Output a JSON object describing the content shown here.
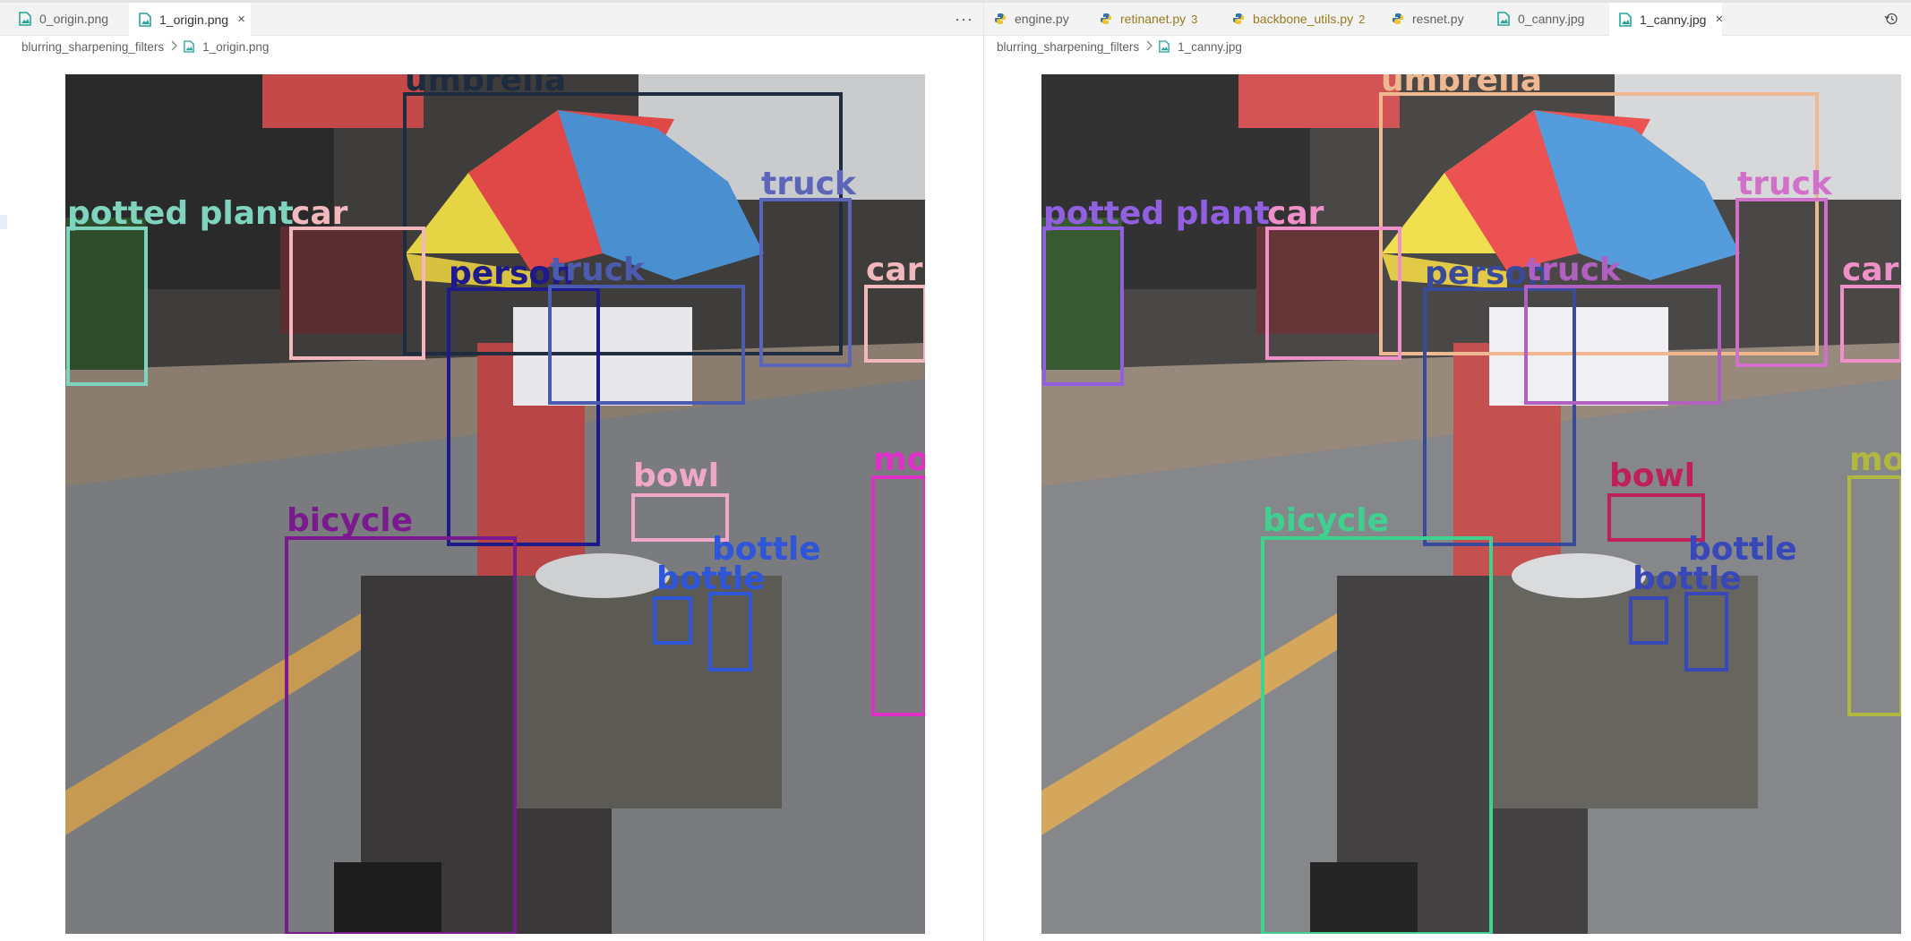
{
  "left_pane": {
    "tabs": [
      {
        "label": "0_origin.png",
        "active": false
      },
      {
        "label": "1_origin.png",
        "active": true,
        "close": "×"
      }
    ],
    "more_label": "···",
    "breadcrumb": {
      "folder": "blurring_sharpening_filters",
      "file": "1_origin.png"
    },
    "labels": {
      "umbrella": "umbrella",
      "potted_plant": "potted plant",
      "car": "car",
      "truck_right": "truck",
      "person": "person",
      "truck_center": "truck",
      "car_edge": "car",
      "bowl": "bowl",
      "motorcycle": "mo",
      "bicycle": "bicycle",
      "bottle_1": "bottle",
      "bottle_2": "bottle"
    }
  },
  "right_pane": {
    "tabs": [
      {
        "label": "engine.py",
        "active": false
      },
      {
        "label": "retinanet.py",
        "active": false,
        "badge": "3"
      },
      {
        "label": "backbone_utils.py",
        "active": false,
        "badge": "2"
      },
      {
        "label": "resnet.py",
        "active": false
      },
      {
        "label": "0_canny.jpg",
        "active": false
      },
      {
        "label": "1_canny.jpg",
        "active": true,
        "close": "×"
      }
    ],
    "breadcrumb": {
      "folder": "blurring_sharpening_filters",
      "file": "1_canny.jpg"
    },
    "labels": {
      "umbrella": "umbrella",
      "potted_plant": "potted plant",
      "car": "car",
      "truck_right": "truck",
      "person": "person",
      "truck_center": "truck",
      "car_edge": "car",
      "bowl": "bowl",
      "motorcycle": "mo",
      "bicycle": "bicycle",
      "bottle_1": "bottle",
      "bottle_2": "bottle"
    }
  },
  "colors": {
    "python_icon": "#3572A5",
    "image_icon": "#26a69a",
    "modified_text": "#9a7a1f"
  },
  "icons": [
    "image-file-icon",
    "python-file-icon",
    "close-icon",
    "more-actions-icon",
    "history-icon",
    "chevron-right-icon"
  ]
}
